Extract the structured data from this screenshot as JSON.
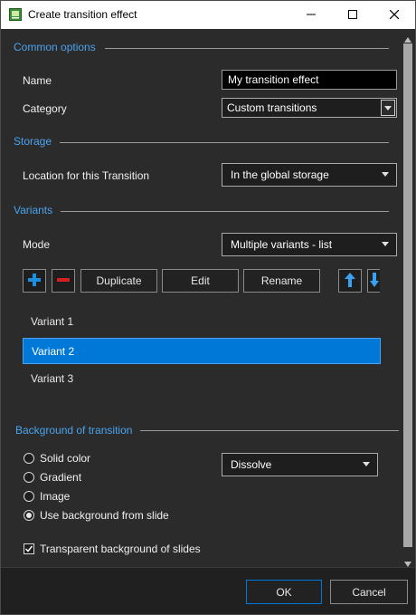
{
  "window": {
    "title": "Create transition effect",
    "icons": {
      "app": "app-icon",
      "minimize": "minimize-icon",
      "maximize": "maximize-icon",
      "close": "close-icon"
    }
  },
  "common_options": {
    "section_title": "Common options",
    "name_label": "Name",
    "name_value": "My transition effect",
    "category_label": "Category",
    "category_value": "Custom transitions"
  },
  "storage": {
    "section_title": "Storage",
    "location_label": "Location for this Transition",
    "location_value": "In the global storage"
  },
  "variants": {
    "section_title": "Variants",
    "mode_label": "Mode",
    "mode_value": "Multiple variants - list",
    "buttons": {
      "duplicate": "Duplicate",
      "edit": "Edit",
      "rename": "Rename"
    },
    "items": [
      "Variant 1",
      "Variant 2",
      "Variant 3"
    ],
    "selected_index": 1
  },
  "background": {
    "section_title": "Background of transition",
    "options": [
      "Solid color",
      "Gradient",
      "Image",
      "Use background from slide"
    ],
    "selected_option": "Use background from slide",
    "effect_value": "Dissolve",
    "transparent_label": "Transparent background of slides",
    "transparent_checked": true
  },
  "footer": {
    "ok": "OK",
    "cancel": "Cancel"
  },
  "colors": {
    "accent": "#4aa3ef",
    "selection": "#0078d7",
    "add": "#1e8fe0",
    "remove": "#d42020"
  }
}
